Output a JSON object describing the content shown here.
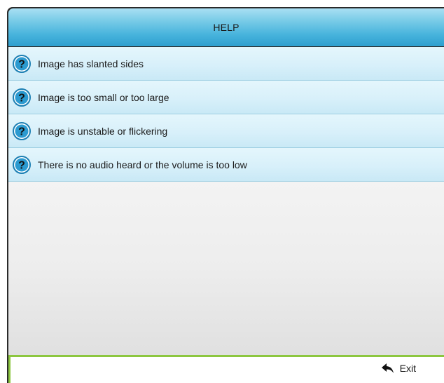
{
  "menu": {
    "title": "HELP",
    "items": [
      {
        "label": "Image has slanted sides",
        "icon": "question-icon"
      },
      {
        "label": "Image is too small or too large",
        "icon": "question-icon"
      },
      {
        "label": "Image is unstable or flickering",
        "icon": "question-icon"
      },
      {
        "label": "There is no audio heard or the volume is too low",
        "icon": "question-icon"
      }
    ]
  },
  "footer": {
    "exit_label": "Exit",
    "exit_icon": "return-arrow-icon"
  },
  "colors": {
    "header_blue": "#46b3dc",
    "item_light_blue": "#d8f0fa",
    "footer_accent_green": "#8cc63f"
  }
}
